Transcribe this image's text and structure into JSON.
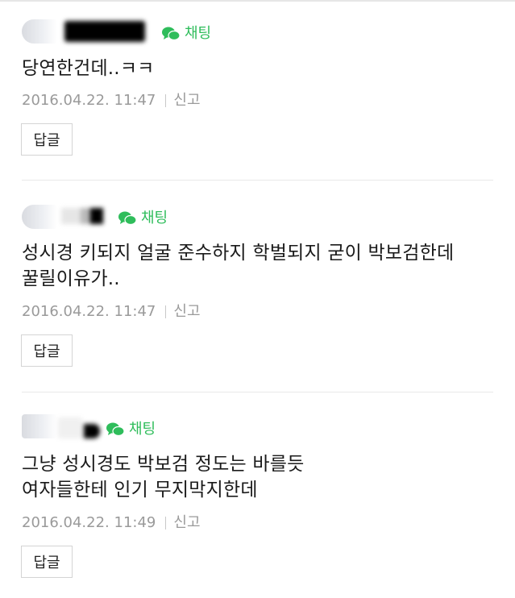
{
  "comments": [
    {
      "chat_label": "채팅",
      "text": [
        "당연한건데..ㅋㅋ"
      ],
      "date": "2016.04.22. 11:47",
      "report": "신고",
      "reply": "답글"
    },
    {
      "chat_label": "채팅",
      "text": [
        "성시경 키되지 얼굴 준수하지 학벌되지 굳이 박보검한데",
        "꿀릴이유가.."
      ],
      "date": "2016.04.22. 11:47",
      "report": "신고",
      "reply": "답글"
    },
    {
      "chat_label": "채팅",
      "text": [
        "그냥 성시경도 박보검 정도는 바를듯",
        "여자들한테 인기 무지막지한데"
      ],
      "date": "2016.04.22. 11:49",
      "report": "신고",
      "reply": "답글"
    }
  ],
  "icons": {
    "chat": "chat-bubble-icon",
    "avatar": "avatar"
  },
  "colors": {
    "chat_green": "#2fbd5b",
    "meta_gray": "#9a9a9a",
    "divider": "#e8e8e8"
  }
}
